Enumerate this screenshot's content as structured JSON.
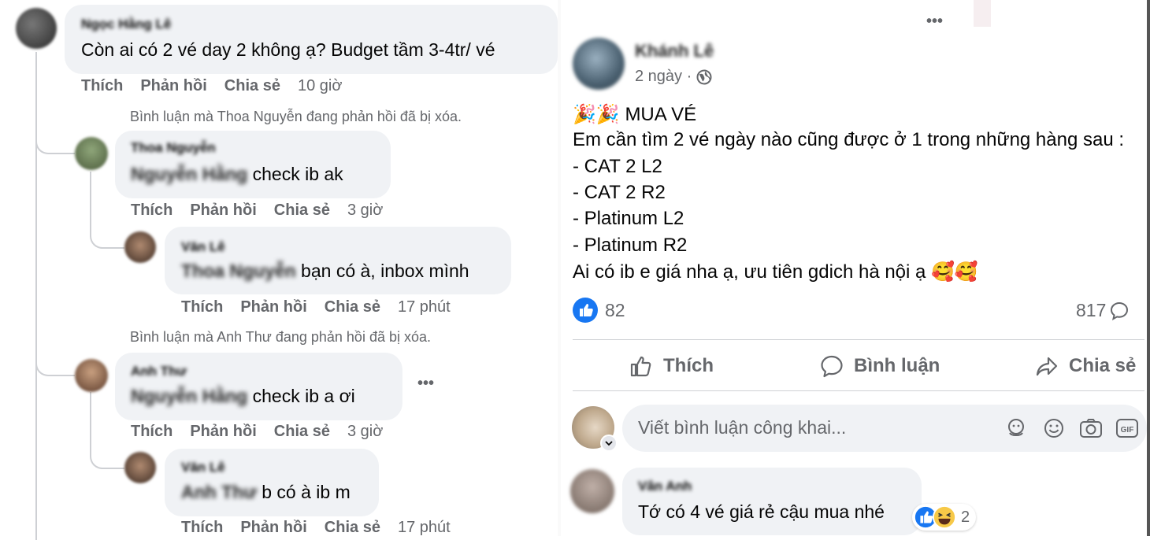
{
  "left": {
    "top_comment": {
      "author": "Ngọc Hằng Lê",
      "text": "Còn ai có 2 vé day 2 không ạ? Budget tầm 3-4tr/ vé",
      "actions": [
        "Thích",
        "Phản hồi",
        "Chia sẻ"
      ],
      "time": "10 giờ"
    },
    "deleted_1": "Bình luận mà Thoa Nguyễn đang phản hồi đã bị xóa.",
    "reply_1": {
      "author": "Thoa Nguyễn",
      "mention": "Nguyễn Hằng",
      "text": " check ib ak",
      "actions": [
        "Thích",
        "Phản hồi",
        "Chia sẻ"
      ],
      "time": "3 giờ"
    },
    "reply_1_1": {
      "author": "Văn Lê",
      "mention": "Thoa Nguyễn",
      "text": " bạn có à, inbox mình",
      "actions": [
        "Thích",
        "Phản hồi",
        "Chia sẻ"
      ],
      "time": "17 phút"
    },
    "deleted_2": "Bình luận mà Anh Thư đang phản hồi đã bị xóa.",
    "reply_2": {
      "author": "Anh Thư",
      "mention": "Nguyễn Hằng",
      "text": " check ib a ơi",
      "more": "•••",
      "actions": [
        "Thích",
        "Phản hồi",
        "Chia sẻ"
      ],
      "time": "3 giờ"
    },
    "reply_2_1": {
      "author": "Văn Lê",
      "mention": "Anh Thư",
      "text": " b có à ib m",
      "actions": [
        "Thích",
        "Phản hồi",
        "Chia sẻ"
      ],
      "time": "17 phút"
    }
  },
  "post": {
    "more": "•••",
    "author": "Khánh Lê",
    "time": "2 ngày ·",
    "lines": [
      "MUA VÉ",
      "Em cần tìm 2 vé ngày nào cũng được ở 1 trong những hàng sau :",
      "- CAT 2 L2",
      "- CAT 2 R2",
      "- Platinum L2",
      "- Platinum R2",
      "Ai có ib e giá nha ạ, ưu tiên gdich hà nội ạ"
    ],
    "emoji_prefix": "🎉🎉",
    "emoji_suffix": "🥰🥰",
    "like_count": "82",
    "comment_count": "817",
    "buttons": {
      "like": "Thích",
      "comment": "Bình luận",
      "share": "Chia sẻ"
    },
    "comment_placeholder": "Viết bình luận công khai...",
    "comment": {
      "author": "Vân Anh",
      "text": "Tớ có 4 vé giá rẻ cậu mua nhé",
      "reaction_count": "2"
    },
    "accent": "#1877f2"
  }
}
